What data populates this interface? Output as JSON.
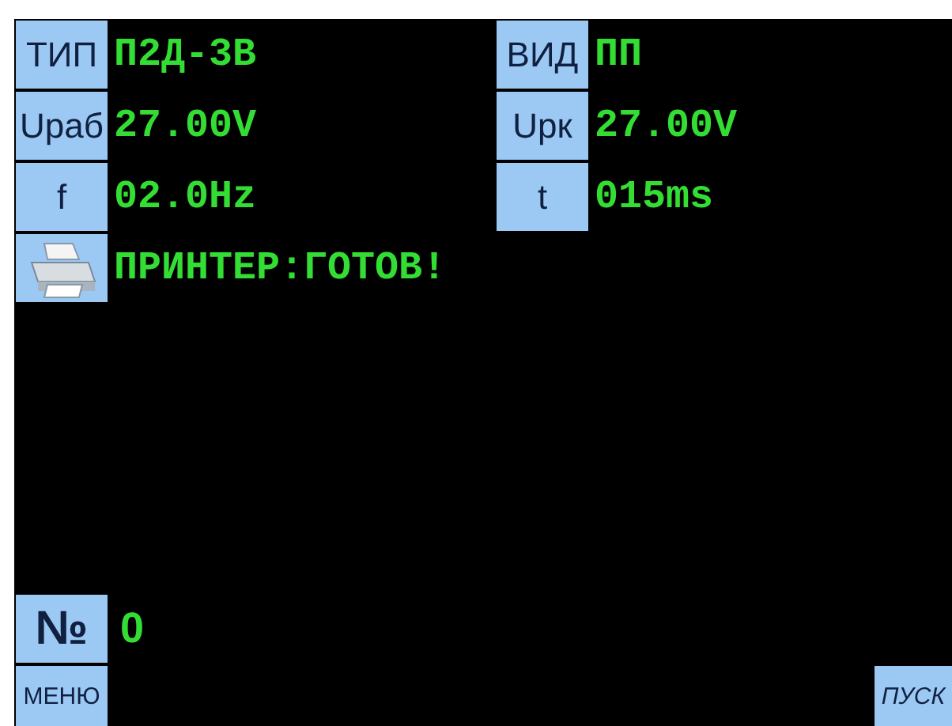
{
  "fields": [
    {
      "label": "ТИП",
      "value": "П2Д-3В"
    },
    {
      "label": "ВИД",
      "value": "ПП"
    },
    {
      "label": "Uраб",
      "value": "27.00V"
    },
    {
      "label": "Uрк",
      "value": "27.00V"
    },
    {
      "label": "f",
      "value": "02.0Hz"
    },
    {
      "label": "t",
      "value": "015ms"
    }
  ],
  "printer": {
    "status": "ПРИНТЕР:ГОТОВ!"
  },
  "counter": {
    "label": "№",
    "value": "0"
  },
  "buttons": [
    {
      "label": "МЕНЮ"
    },
    {
      "label": "ПУСК"
    }
  ]
}
